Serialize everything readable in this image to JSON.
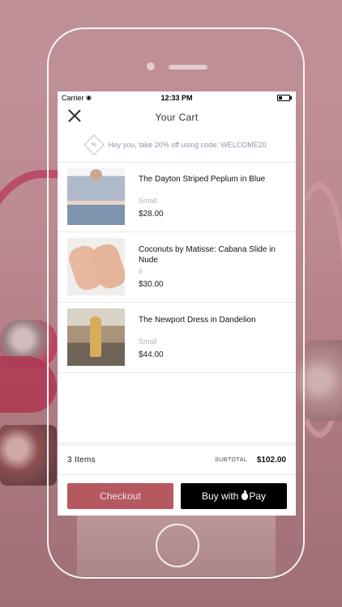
{
  "status_bar": {
    "carrier": "Carrier",
    "wifi_icon": "wifi-icon",
    "time": "12:33 PM",
    "battery_icon": "battery-icon"
  },
  "nav": {
    "title": "Your Cart",
    "close_icon": "close-icon"
  },
  "promo": {
    "icon": "percent-badge-icon",
    "icon_glyph": "%",
    "text": "Hey you, take 20% off using code: WELCOME20"
  },
  "cart": {
    "items": [
      {
        "name": "The Dayton Striped Peplum in Blue",
        "variant": "Small",
        "price": "$28.00"
      },
      {
        "name": "Coconuts by Matisse: Cabana Slide in Nude",
        "variant": "6",
        "price": "$30.00"
      },
      {
        "name": "The Newport Dress in Dandelion",
        "variant": "Small",
        "price": "$44.00"
      }
    ]
  },
  "summary": {
    "items_count": "3  Items",
    "subtotal_label": "SUBTOTAL",
    "subtotal_value": "$102.00"
  },
  "actions": {
    "checkout_label": "Checkout",
    "applepay_prefix": "Buy with",
    "applepay_suffix": "Pay",
    "apple_icon": "apple-icon"
  },
  "colors": {
    "checkout_button": "#b55860",
    "applepay_button": "#000000",
    "background_tint": "#b98a90"
  }
}
